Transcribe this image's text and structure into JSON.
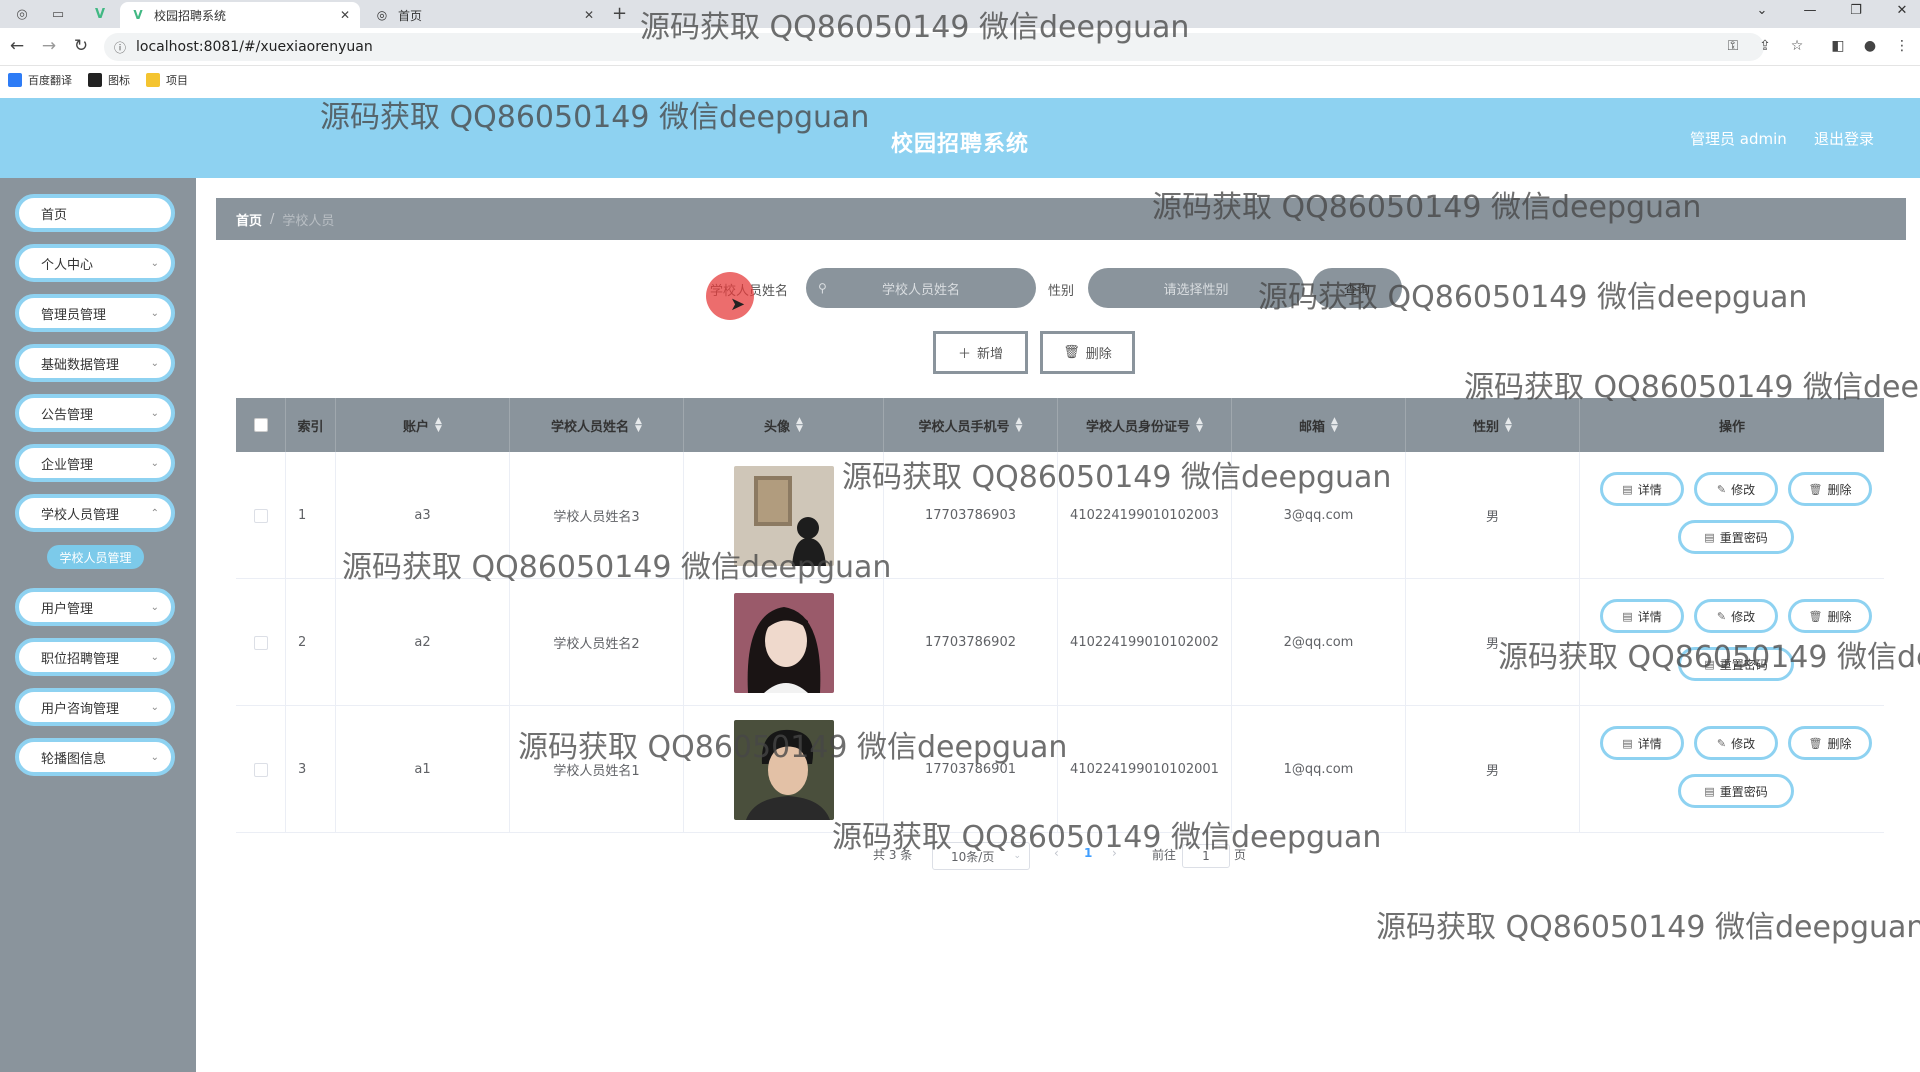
{
  "browser": {
    "tabs": [
      {
        "title": "校园招聘系统",
        "active": true
      },
      {
        "title": "首页",
        "active": false
      }
    ],
    "url": "localhost:8081/#/xuexiaorenyuan",
    "bookmarks": [
      "百度翻译",
      "图标",
      "项目"
    ]
  },
  "header": {
    "title": "校园招聘系统",
    "user_label": "管理员 admin",
    "logout_label": "退出登录"
  },
  "sidebar": {
    "items": [
      {
        "label": "首页",
        "has_children": false
      },
      {
        "label": "个人中心",
        "has_children": true
      },
      {
        "label": "管理员管理",
        "has_children": true
      },
      {
        "label": "基础数据管理",
        "has_children": true
      },
      {
        "label": "公告管理",
        "has_children": true
      },
      {
        "label": "企业管理",
        "has_children": true
      },
      {
        "label": "学校人员管理",
        "has_children": true
      },
      {
        "label": "用户管理",
        "has_children": true
      },
      {
        "label": "职位招聘管理",
        "has_children": true
      },
      {
        "label": "用户咨询管理",
        "has_children": true
      },
      {
        "label": "轮播图信息",
        "has_children": true
      }
    ],
    "active_sub": "学校人员管理"
  },
  "breadcrumb": {
    "home": "首页",
    "separator": "/",
    "current": "学校人员"
  },
  "search": {
    "name_label": "学校人员姓名",
    "name_placeholder": "学校人员姓名",
    "gender_label": "性别",
    "gender_placeholder": "请选择性别",
    "query_label": "查询"
  },
  "toolbar": {
    "add_label": "新增",
    "delete_label": "删除"
  },
  "table": {
    "columns": [
      "索引",
      "账户",
      "学校人员姓名",
      "头像",
      "学校人员手机号",
      "学校人员身份证号",
      "邮箱",
      "性别",
      "操作"
    ],
    "rows": [
      {
        "index": "1",
        "account": "a3",
        "name": "学校人员姓名3",
        "phone": "17703786903",
        "id_card": "410224199010102003",
        "email": "3@qq.com",
        "gender": "男"
      },
      {
        "index": "2",
        "account": "a2",
        "name": "学校人员姓名2",
        "phone": "17703786902",
        "id_card": "410224199010102002",
        "email": "2@qq.com",
        "gender": "男"
      },
      {
        "index": "3",
        "account": "a1",
        "name": "学校人员姓名1",
        "phone": "17703786901",
        "id_card": "410224199010102001",
        "email": "1@qq.com",
        "gender": "男"
      }
    ],
    "actions": {
      "detail": "详情",
      "edit": "修改",
      "delete": "删除",
      "reset_password": "重置密码"
    }
  },
  "pagination": {
    "total_label": "共 3 条",
    "page_size": "10条/页",
    "current_page": "1",
    "goto_label": "前往",
    "goto_value": "1",
    "page_unit": "页"
  },
  "watermark_text": "源码获取 QQ86050149 微信deepguan",
  "colors": {
    "header": "#8ed2f1",
    "sidebar": "#8a949c",
    "accent": "#7ccaea"
  }
}
